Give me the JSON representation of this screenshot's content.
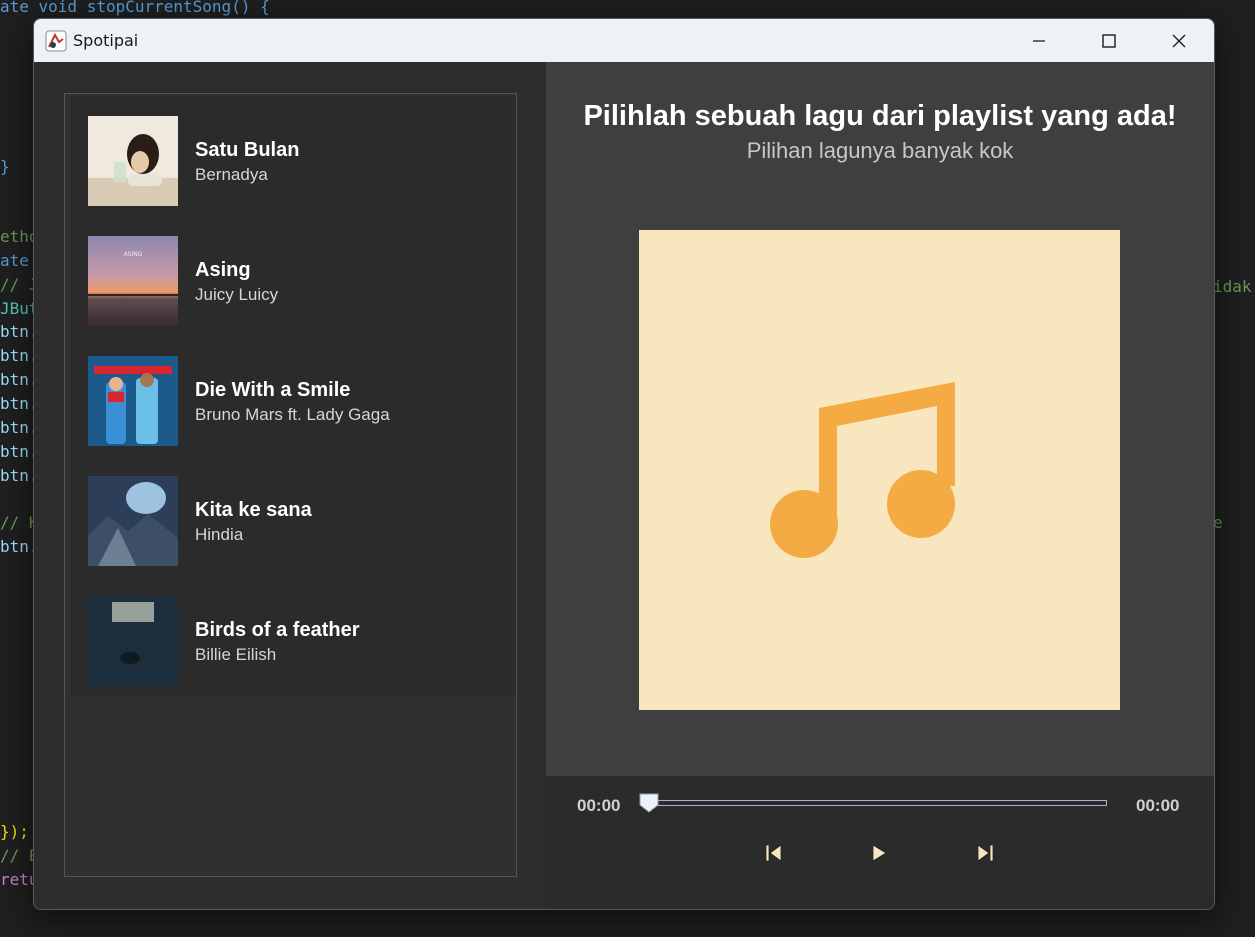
{
  "window": {
    "title": "Spotipai"
  },
  "code": {
    "lines": [
      {
        "text": "ate void stopCurrentSong() {"
      },
      {
        "text": "}"
      },
      {
        "text": "etho"
      },
      {
        "text": "ate"
      },
      {
        "text": "// J"
      },
      {
        "text": "JBut"
      },
      {
        "text": "btn."
      },
      {
        "text": "btn."
      },
      {
        "text": "btn."
      },
      {
        "text": "btn."
      },
      {
        "text": "btn."
      },
      {
        "text": "btn."
      },
      {
        "text": "btn."
      },
      {
        "text": "// K"
      },
      {
        "text": "btn."
      },
      {
        "text": "});"
      },
      {
        "text": "// E"
      },
      {
        "text": "retu"
      },
      {
        "text": "idak"
      },
      {
        "text": "e"
      }
    ]
  },
  "playlist": [
    {
      "title": "Satu Bulan",
      "artist": "Bernadya"
    },
    {
      "title": "Asing",
      "artist": "Juicy Luicy"
    },
    {
      "title": "Die With a Smile",
      "artist": "Bruno Mars ft. Lady Gaga"
    },
    {
      "title": "Kita ke sana",
      "artist": "Hindia"
    },
    {
      "title": "Birds of a feather",
      "artist": "Billie Eilish"
    }
  ],
  "main": {
    "headline": "Pilihlah sebuah lagu dari playlist yang ada!",
    "subheadline": "Pilihan lagunya banyak kok",
    "art_icon": "music-note-icon",
    "art_color": "#f5ab43",
    "art_bg": "#f8e6be"
  },
  "player": {
    "current_time": "00:00",
    "total_time": "00:00",
    "progress": 0,
    "prev_icon": "skip-previous-icon",
    "play_icon": "play-icon",
    "next_icon": "skip-next-icon"
  }
}
